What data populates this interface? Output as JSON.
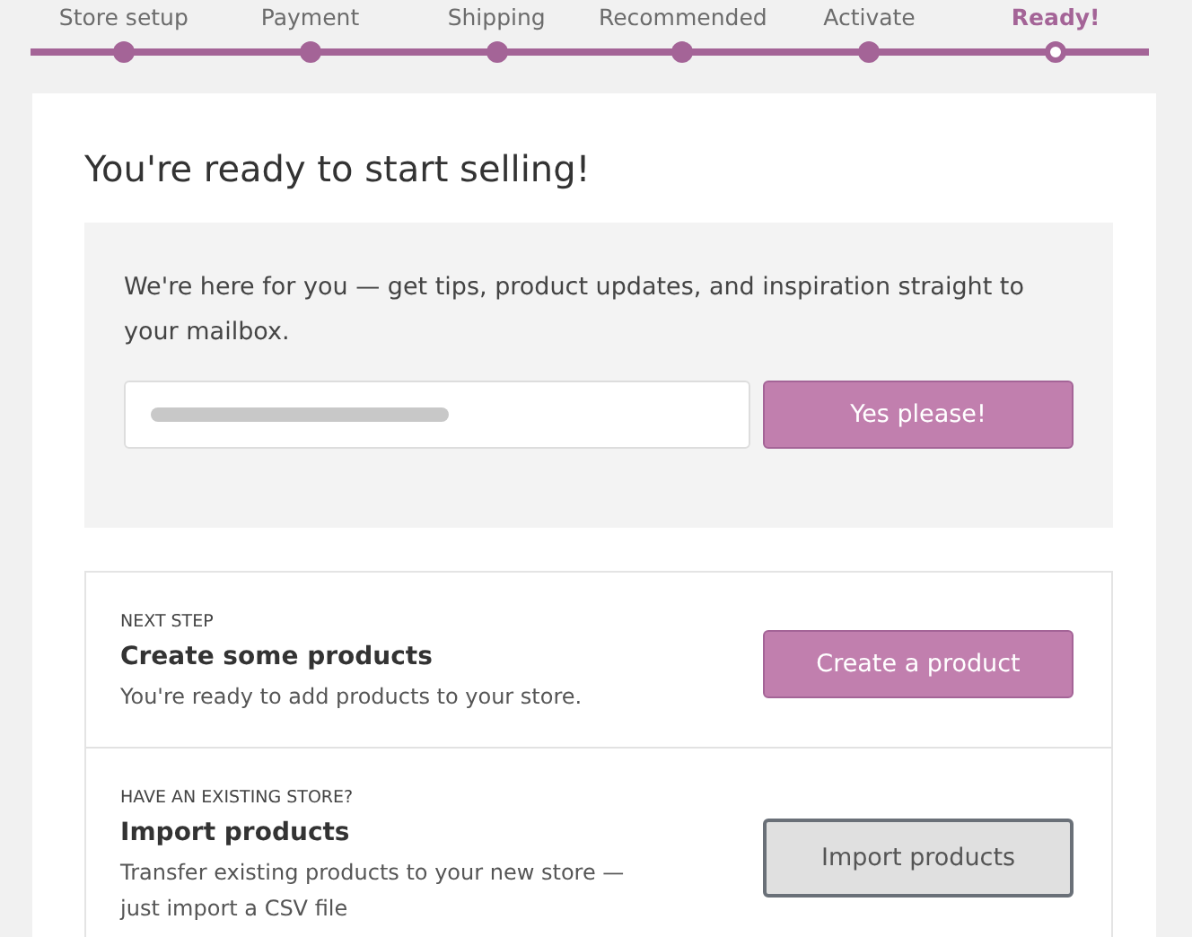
{
  "steps": [
    {
      "label": "Store setup",
      "selected": false
    },
    {
      "label": "Payment",
      "selected": false
    },
    {
      "label": "Shipping",
      "selected": false
    },
    {
      "label": "Recommended",
      "selected": false
    },
    {
      "label": "Activate",
      "selected": false
    },
    {
      "label": "Ready!",
      "selected": true
    }
  ],
  "title": "You're ready to start selling!",
  "newsletter": {
    "text": "We're here for you — get tips, product updates, and inspiration straight to your mailbox.",
    "button": "Yes please!"
  },
  "next_steps": [
    {
      "eyebrow": "NEXT STEP",
      "heading": "Create some products",
      "description": "You're ready to add products to your store.",
      "button": "Create a product",
      "kind": "primary"
    },
    {
      "eyebrow": "HAVE AN EXISTING STORE?",
      "heading": "Import products",
      "description": "Transfer existing products to your new store — just import a CSV file",
      "button": "Import products",
      "kind": "secondary"
    }
  ]
}
